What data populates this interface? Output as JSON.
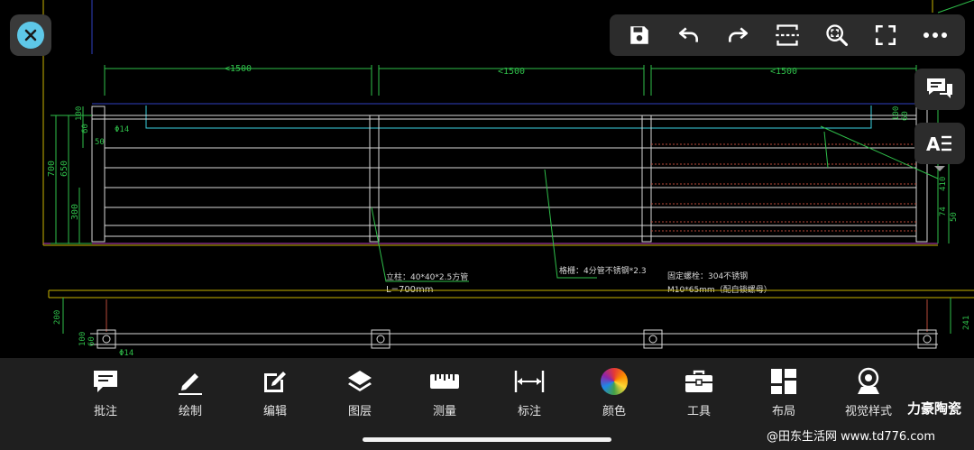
{
  "canvas": {
    "dims": [
      "<1500",
      "<1500",
      "<1500"
    ],
    "left_dims": [
      "100",
      "60",
      "50",
      "100",
      "700",
      "650",
      "300"
    ],
    "right_dims": [
      "100",
      "60",
      "410",
      "74",
      "50"
    ],
    "bottom_dims": [
      "200",
      "100",
      "60"
    ],
    "right_bottom_dim": "241",
    "phi": "Φ14",
    "phi2": "Φ14",
    "note_post_1": "立柱：40*40*2.5方管",
    "note_post_2": "L=700mm",
    "note_rail": "格栅：4分管不锈钢*2.3",
    "note_bolt_1": "固定螺栓：304不锈钢",
    "note_bolt_2": "M10*65mm（配自锁螺母）"
  },
  "top_toolbar": [
    {
      "name": "save",
      "icon": "save-icon"
    },
    {
      "name": "undo",
      "icon": "undo-icon"
    },
    {
      "name": "redo",
      "icon": "redo-icon"
    },
    {
      "name": "frame-select",
      "icon": "frame-select-icon"
    },
    {
      "name": "zoom-extents",
      "icon": "zoom-fit-icon"
    },
    {
      "name": "fullscreen",
      "icon": "fullscreen-icon"
    },
    {
      "name": "more",
      "icon": "more-icon"
    }
  ],
  "side_buttons": [
    {
      "name": "comments",
      "icon": "comment-icon"
    },
    {
      "name": "text-style",
      "icon": "text-style-icon"
    }
  ],
  "bottom_tools": [
    {
      "label": "批注",
      "icon": "annotate-icon"
    },
    {
      "label": "绘制",
      "icon": "pencil-icon"
    },
    {
      "label": "编辑",
      "icon": "edit-icon"
    },
    {
      "label": "图层",
      "icon": "layers-icon"
    },
    {
      "label": "测量",
      "icon": "ruler-icon"
    },
    {
      "label": "标注",
      "icon": "dimension-icon"
    },
    {
      "label": "颜色",
      "icon": "color-wheel-icon"
    },
    {
      "label": "工具",
      "icon": "toolbox-icon"
    },
    {
      "label": "布局",
      "icon": "layout-icon"
    },
    {
      "label": "视觉样式",
      "icon": "visual-style-icon"
    }
  ],
  "brand": "力豪陶瓷",
  "watermark": "@田东生活网 www.td776.com",
  "colors": {
    "accent": "#5ec8e8",
    "cad_dim_green": "#2fbf4a",
    "cad_cyan": "#3ad0e0",
    "cad_white": "#d8d8d8",
    "cad_magenta": "#c040c0",
    "cad_yellow": "#c8b400",
    "cad_red": "#b84a3a"
  }
}
